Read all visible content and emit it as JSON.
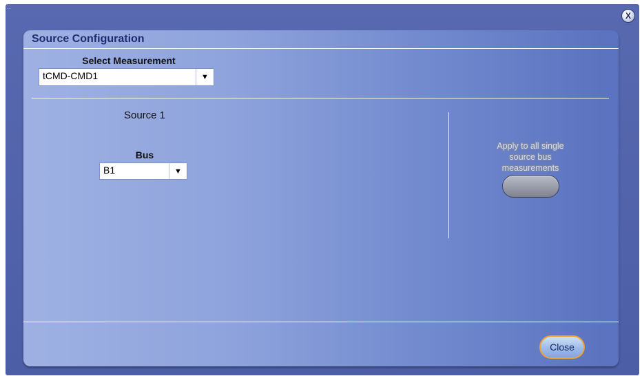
{
  "window": {
    "close_icon_glyph": "X"
  },
  "dialog": {
    "title": "Source Configuration",
    "select_measurement": {
      "label": "Select Measurement",
      "value": "tCMD-CMD1"
    },
    "source": {
      "label": "Source 1",
      "bus_label": "Bus",
      "bus_value": "B1"
    },
    "apply": {
      "text_line1": "Apply to all single",
      "text_line2": "source bus",
      "text_line3": "measurements"
    },
    "close_label": "Close"
  },
  "icons": {
    "dropdown_arrow": "▼",
    "window_grip": "⁚⁚"
  },
  "colors": {
    "outer_frame": "#5869b0",
    "panel_light": "#9fb1e3",
    "panel_dark": "#5a72bf",
    "title_text": "#1f2b6e",
    "close_button_border": "#f0a22a"
  }
}
